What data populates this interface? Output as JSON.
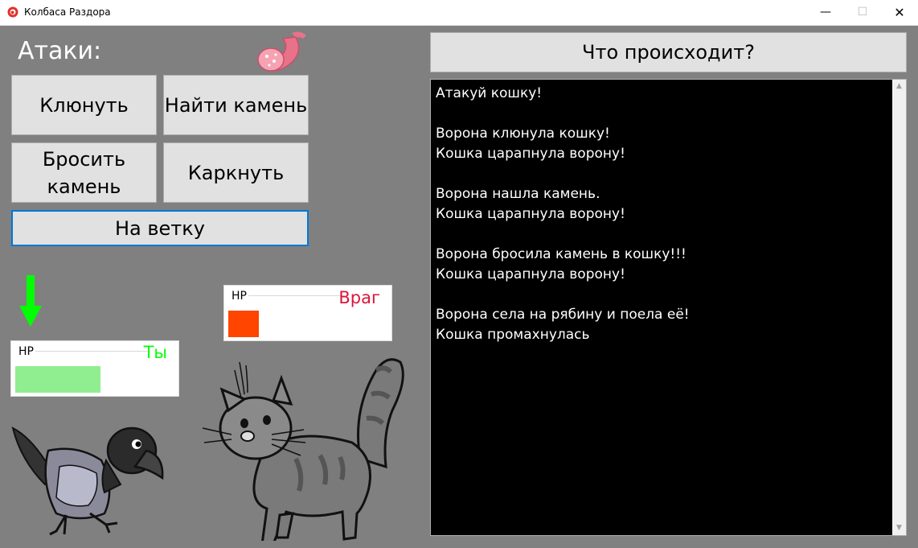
{
  "window": {
    "title": "Колбаса Раздора"
  },
  "attacks": {
    "title": "Атаки:",
    "buttons": {
      "peck": "Клюнуть",
      "find_stone": "Найти камень",
      "throw_line1": "Бросить",
      "throw_line2": "камень",
      "caw": "Каркнуть",
      "branch": "На ветку"
    }
  },
  "enemy": {
    "hp_label": "HP",
    "name": "Враг",
    "hp_fraction": 0.19,
    "bar_color": "#ff4500",
    "name_color": "#dc143c"
  },
  "player": {
    "hp_label": "HP",
    "name": "Ты",
    "hp_fraction": 0.55,
    "bar_color": "#90ee90",
    "name_color": "#00ff00"
  },
  "log": {
    "title": "Что происходит?",
    "lines": [
      "Атакуй кошку!",
      "",
      "Ворона клюнула кошку!",
      "Кошка царапнула ворону!",
      "",
      "Ворона нашла камень.",
      "Кошка царапнула ворону!",
      "",
      "Ворона бросила камень в кошку!!!",
      "Кошка царапнула ворону!",
      "",
      "Ворона села на рябину и поела её!",
      "Кошка промахнулась"
    ]
  },
  "colors": {
    "turn_arrow": "#00ff00",
    "background": "#808080"
  }
}
